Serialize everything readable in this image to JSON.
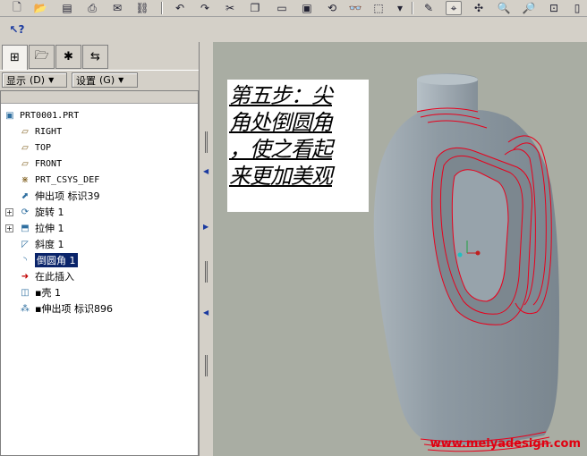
{
  "toolbar": {
    "icons": [
      "new-file-icon",
      "open-folder-icon",
      "save-icon",
      "print-icon",
      "email-icon",
      "link-icon",
      "undo-icon",
      "redo-icon",
      "cut-icon",
      "copy-icon",
      "paste-icon",
      "paste-special-icon",
      "regenerate-icon",
      "find-icon",
      "select-box-icon",
      "dropdown-icon",
      "sketch-icon",
      "datum-display-icon",
      "spin-center-icon",
      "zoom-in-icon",
      "zoom-out-icon",
      "refit-icon",
      "orient-icon"
    ],
    "whats_this_icon": "whats-this-icon"
  },
  "tabs": [
    {
      "name": "model-tree-tab",
      "icon": "tree-icon",
      "active": true
    },
    {
      "name": "folder-tab",
      "icon": "folder-icon",
      "active": false
    },
    {
      "name": "favorites-tab",
      "icon": "star-icon",
      "active": false
    },
    {
      "name": "connections-tab",
      "icon": "connection-icon",
      "active": false
    }
  ],
  "menus": {
    "show_label": "显示",
    "show_key": "(D)",
    "settings_label": "设置",
    "settings_key": "(G)"
  },
  "tree": {
    "items": [
      {
        "label": "PRT0001.PRT",
        "icon": "part-icon",
        "mono": true
      },
      {
        "label": "RIGHT",
        "icon": "datum-plane-icon",
        "mono": true
      },
      {
        "label": "TOP",
        "icon": "datum-plane-icon",
        "mono": true
      },
      {
        "label": "FRONT",
        "icon": "datum-plane-icon",
        "mono": true
      },
      {
        "label": "PRT_CSYS_DEF",
        "icon": "csys-icon",
        "mono": true
      },
      {
        "label": "伸出项 标识39",
        "icon": "protrusion-icon",
        "mono": false
      },
      {
        "label": "旋转 1",
        "icon": "revolve-icon",
        "mono": false,
        "expandable": true
      },
      {
        "label": "拉伸 1",
        "icon": "extrude-icon",
        "mono": false,
        "expandable": true
      },
      {
        "label": "斜度 1",
        "icon": "draft-icon",
        "mono": false
      },
      {
        "label": "倒圆角 1",
        "icon": "round-icon",
        "mono": false,
        "selected": true
      },
      {
        "label": "在此插入",
        "icon": "insert-arrow-icon",
        "mono": false
      },
      {
        "label": "▪壳 1",
        "icon": "shell-icon",
        "mono": false
      },
      {
        "label": "▪伸出项 标识896",
        "icon": "protrusion-group-icon",
        "mono": false
      }
    ]
  },
  "note": {
    "lines": [
      "第五步：尖",
      "角处倒圆角",
      "，使之看起",
      "来更加美观"
    ]
  },
  "watermark": "www.meiyadesign.com",
  "colors": {
    "viewport_bg": "#a9ada3",
    "model_body": "#8e9aa3",
    "edge_red": "#e8001c",
    "selection": "#0a246a"
  }
}
